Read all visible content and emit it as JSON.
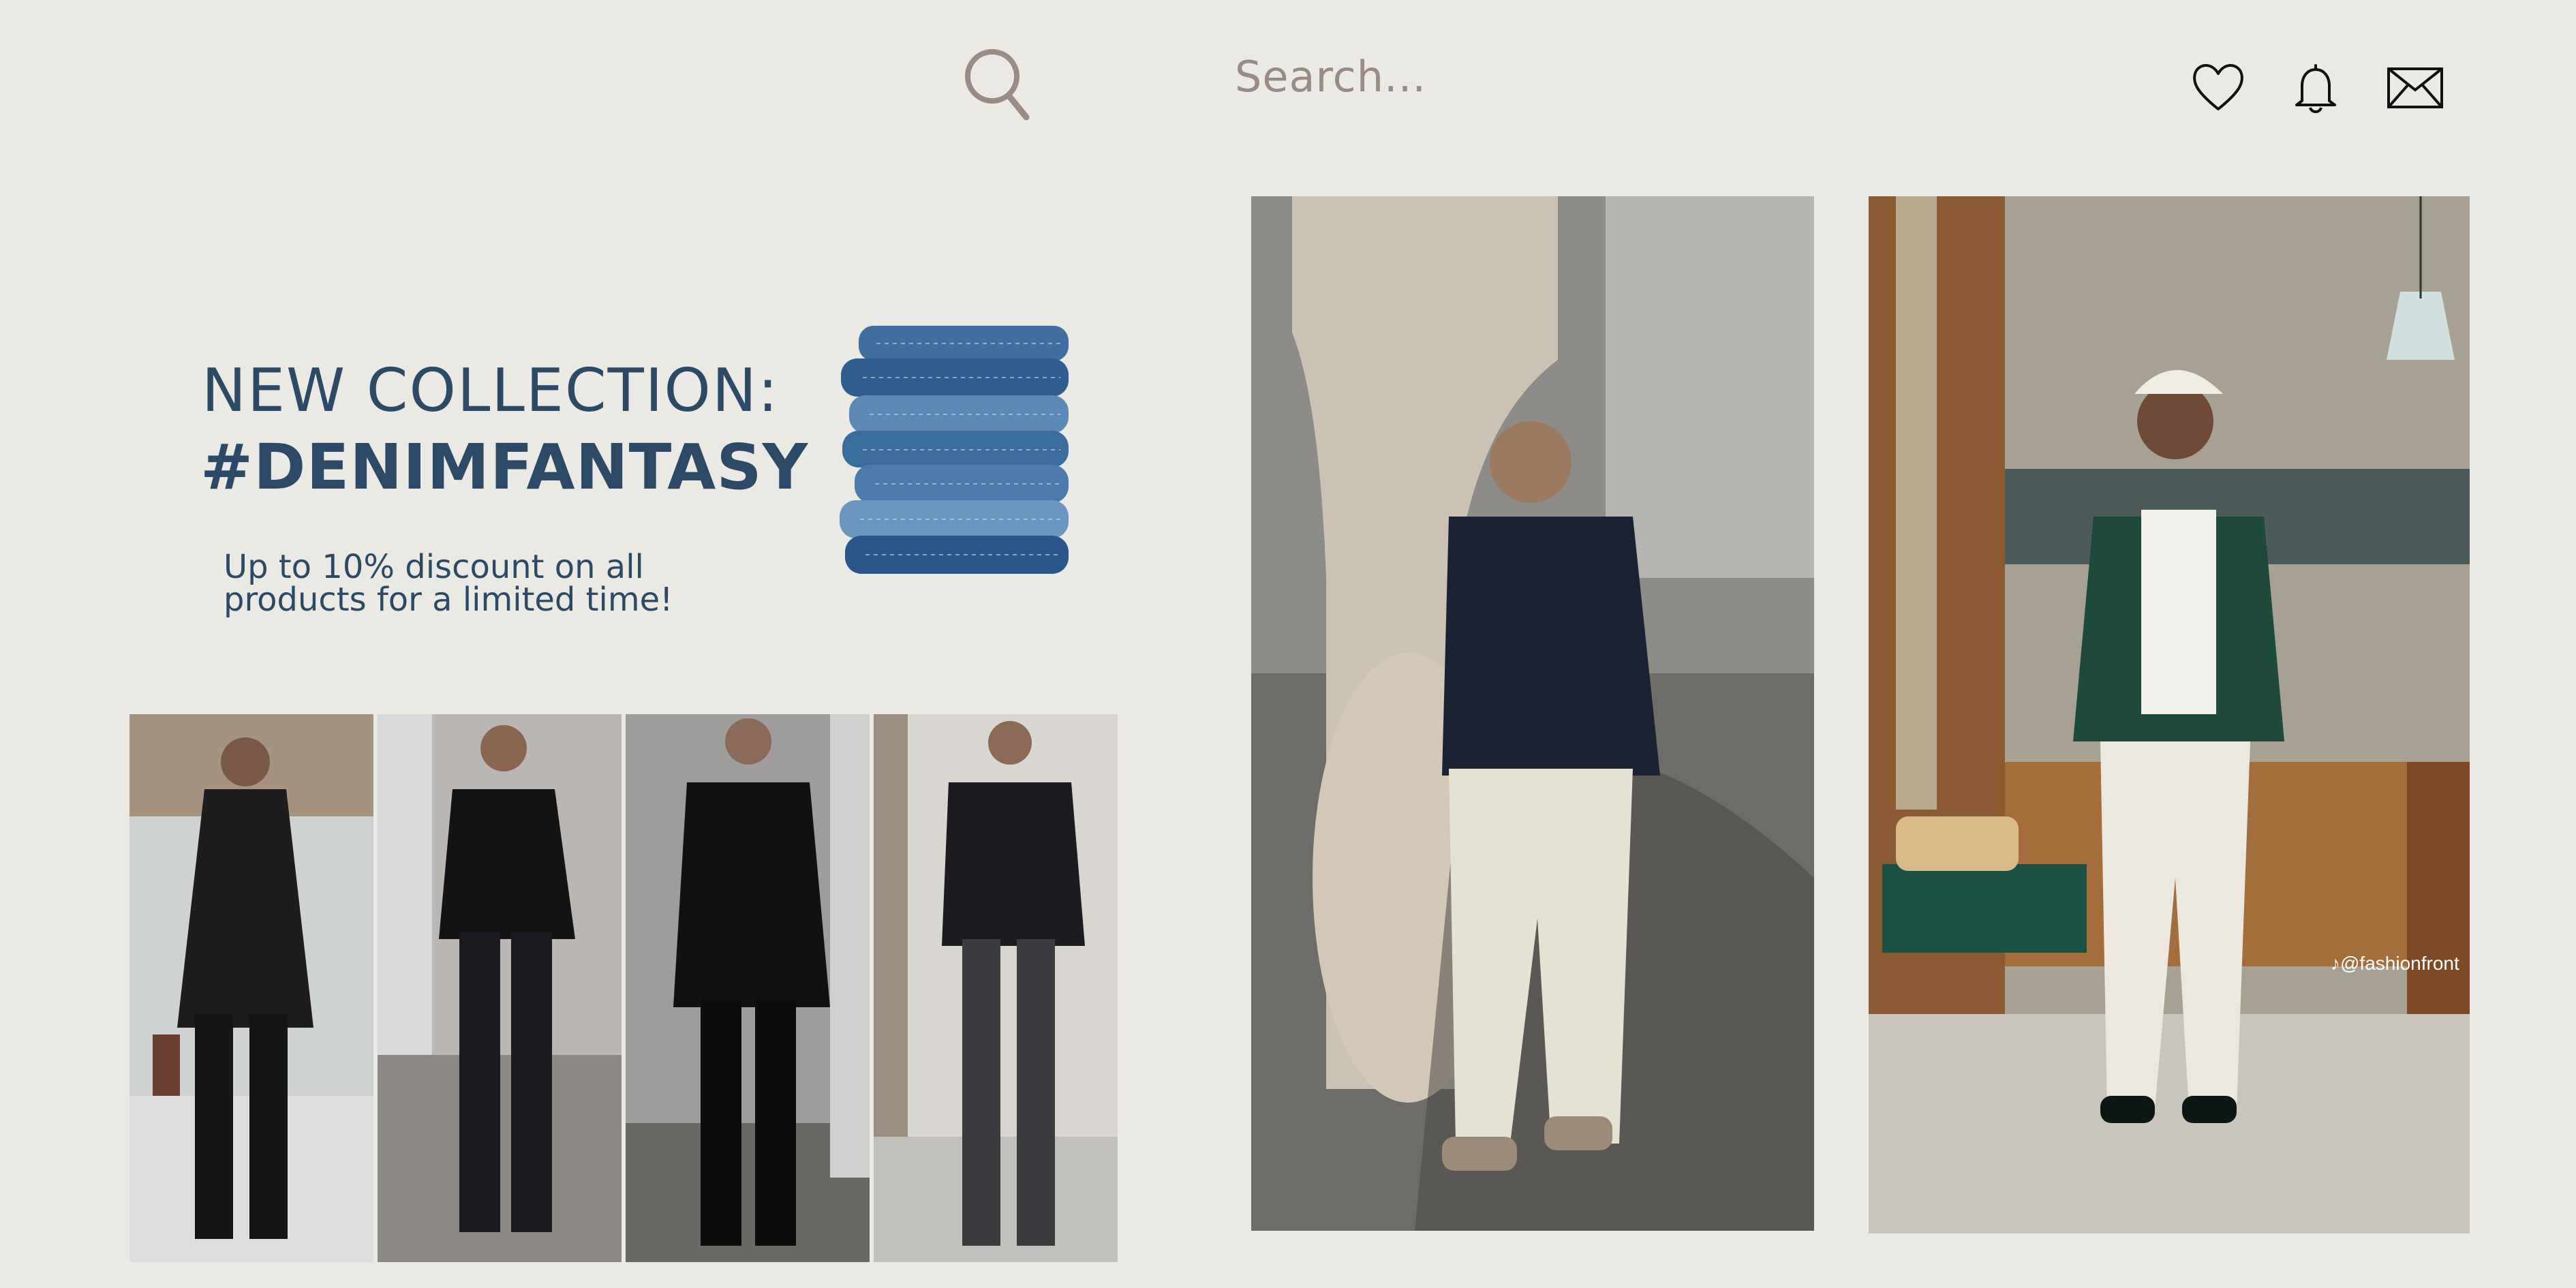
{
  "header": {
    "search": {
      "text": "Search...",
      "icon": "search-icon"
    },
    "actions": [
      {
        "name": "favorites",
        "icon": "heart-icon"
      },
      {
        "name": "notifications",
        "icon": "bell-icon"
      },
      {
        "name": "messages",
        "icon": "mail-icon"
      }
    ]
  },
  "promo": {
    "heading": "NEW COLLECTION:",
    "hashtag": "#DENIMFANTASY",
    "discount": "Up to 10% discount on all products for a limited time!"
  },
  "feature": {
    "watermark": "♪@fashionfront"
  },
  "colors": {
    "background": "#ebe9e4",
    "brand_text": "#2c4a66",
    "search_text": "#9b8b86"
  }
}
